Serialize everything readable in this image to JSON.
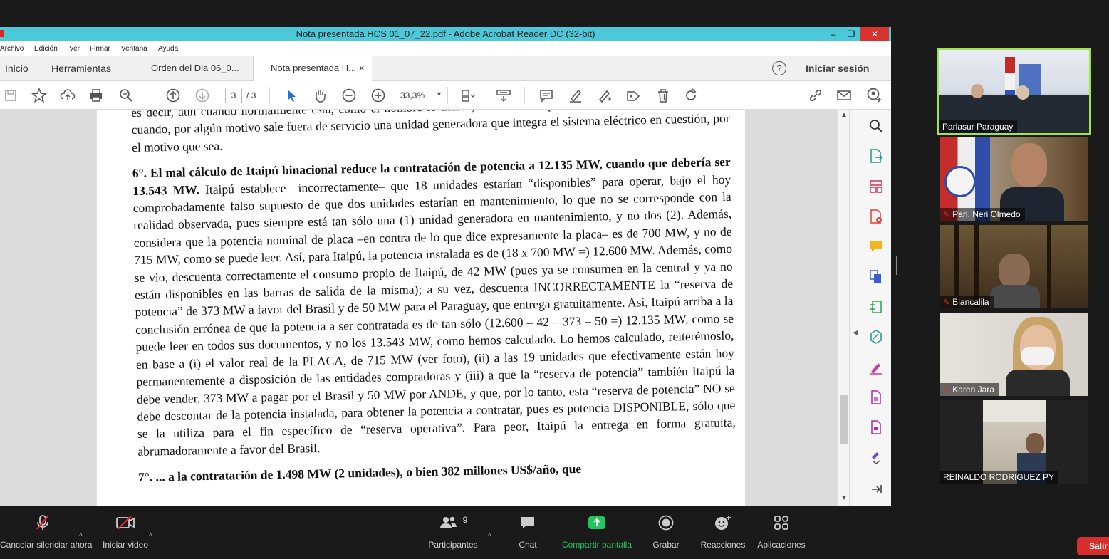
{
  "window": {
    "title": "Nota presentada HCS 01_07_22.pdf - Adobe Acrobat Reader DC (32-bit)",
    "minimize": "–",
    "maximize": "❐",
    "close": "✕"
  },
  "menu": [
    "Archivo",
    "Edición",
    "Ver",
    "Firmar",
    "Ventana",
    "Ayuda"
  ],
  "tabs": {
    "home": "Inicio",
    "tools": "Herramientas",
    "doc1": "Orden del Dia 06_0...",
    "doc2": "Nota presentada H...",
    "close": "×",
    "help": "?",
    "signin": "Iniciar sesión"
  },
  "toolbar": {
    "page_current": "3",
    "page_total": "/ 3",
    "zoom": "33,3%"
  },
  "document": {
    "line0": "es decir, aún cuando normalmente está, como el nombre lo indica, en “reserva operativa”, en condiciones de operar cuando, por algún motivo sale fuera de servicio una unidad generadora que integra el sistema eléctrico en cuestión, por el motivo que sea.",
    "p6_bold": "6°. El mal cálculo de Itaipú binacional reduce la contratación de potencia a 12.135 MW, cuando que debería ser 13.543 MW.",
    "p6_text": " Itaipú establece –incorrectamente– que 18 unidades estarían “disponibles” para operar, bajo el hoy comprobadamente falso supuesto de que dos unidades estarían en mantenimiento, lo que no se corresponde con la realidad observada, pues siempre está tan sólo una (1) unidad generadora en mantenimiento, y no dos (2). Además, considera que la potencia nominal de placa –en contra de lo que dice expresamente la placa– es de 700 MW, y no de 715 MW, como se puede leer. Así, para Itaipú, la potencia instalada es de (18 x 700 MW =) 12.600 MW. Además, como se vio, descuenta correctamente el consumo propio de Itaipú, de 42 MW (pues ya se consumen en la central y ya no están disponibles en las barras de salida de la misma); a su vez, descuenta INCORRECTAMENTE la “reserva de potencia” de 373 MW a favor del Brasil y de 50 MW para el Paraguay, que entrega gratuitamente. Así, Itaipú arriba a la conclusión errónea de que la potencia a ser contratada es de tan sólo (12.600 – 42 – 373 – 50 =) 12.135 MW, como se puede leer en todos sus documentos, y no los 13.543 MW, como hemos calculado. Lo hemos calculado, reiterémoslo, en base a (i) el valor real de la PLACA, de 715 MW (ver foto), (ii) a las 19 unidades que efectivamente están hoy permanentemente a disposición de las entidades compradoras y (iii) a que la “reserva de potencia” también Itaipú la debe vender, 373 MW a pagar por el Brasil y 50 MW por ANDE, y que, por lo tanto, esta “reserva de potencia” NO se debe descontar de la potencia instalada, para obtener la potencia a contratar, pues es potencia DISPONIBLE, sólo que se la utiliza para el fin específico de “reserva operativa”. Para peor, Itaipú la entrega en forma gratuita, abrumadoramente a favor del Brasil.",
    "p7_bold": "7°. ... a la contratación de 1.498 MW (2 unidades), o bien 382 millones US$/año, que"
  },
  "participants": [
    {
      "name": "Parlasur Paraguay",
      "muted": false
    },
    {
      "name": "Parl. Neri Olmedo",
      "muted": true
    },
    {
      "name": "Blancalila",
      "muted": true
    },
    {
      "name": "Karen Jara",
      "muted": true
    },
    {
      "name": "REINALDO RODRIGUEZ PY",
      "muted": false
    }
  ],
  "zoombar": {
    "unmute": "Cancelar silenciar ahora",
    "video": "Iniciar video",
    "participants": "Participantes",
    "participants_count": "9",
    "chat": "Chat",
    "share": "Compartir pantalla",
    "record": "Grabar",
    "reactions": "Reacciones",
    "apps": "Aplicaciones",
    "leave": "Salir"
  },
  "colors": {
    "titlebar": "#4cc8d8",
    "share_green": "#22c55e",
    "leave_red": "#d92e2e",
    "active_speaker": "#9fe34e"
  }
}
